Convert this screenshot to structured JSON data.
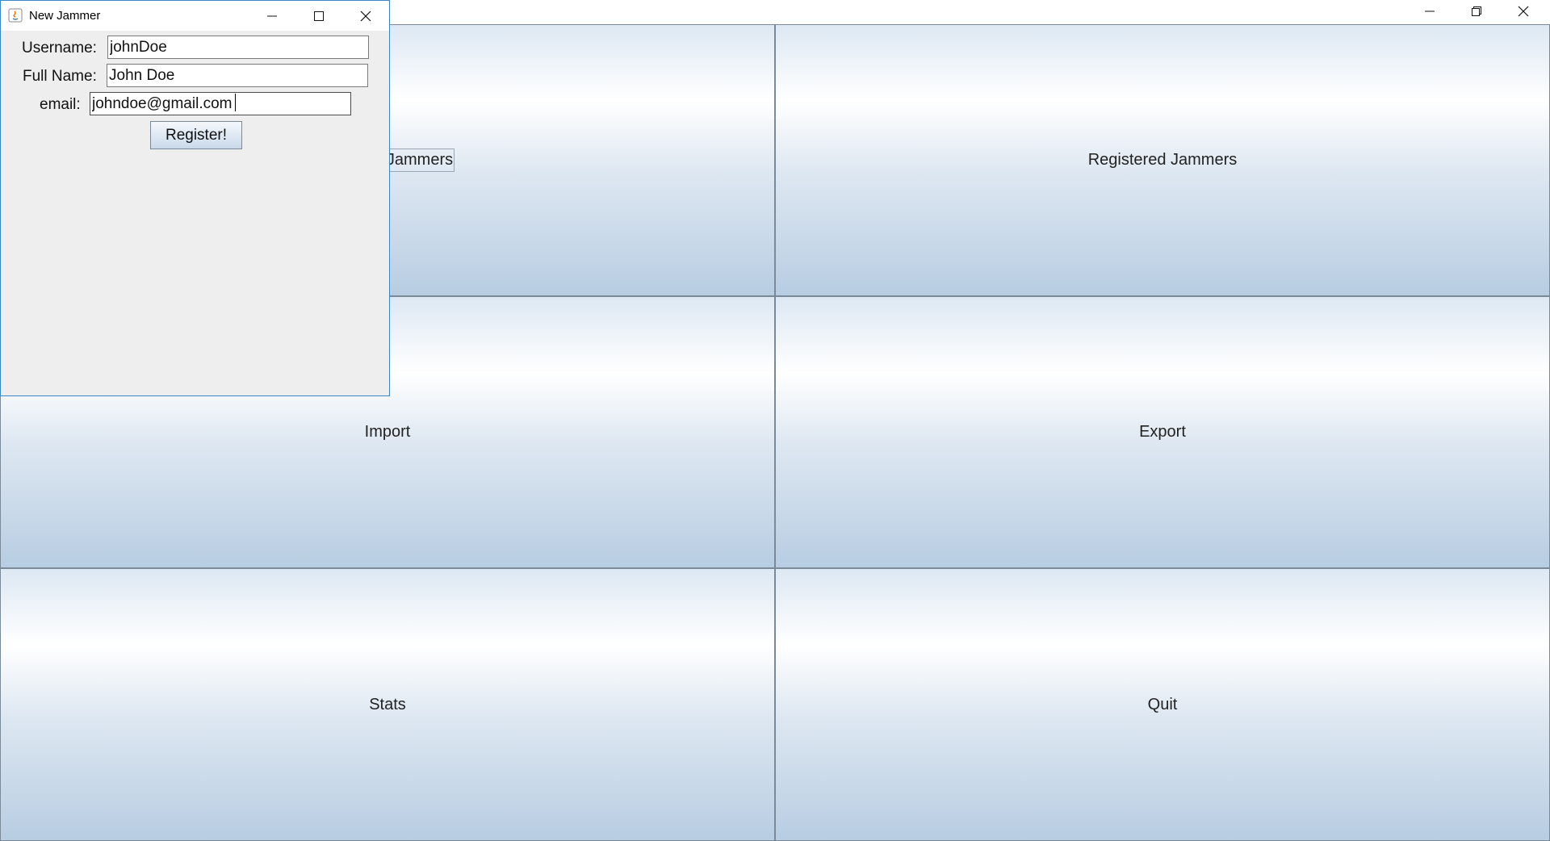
{
  "main_window": {
    "caption_buttons": {
      "minimize_icon": "minimize-icon",
      "restore_icon": "restore-icon",
      "close_icon": "close-icon"
    },
    "buttons": {
      "top_left": "Register Jammers",
      "top_right": "Registered Jammers",
      "middle_left": "Import",
      "middle_right": "Export",
      "bottom_left": "Stats",
      "bottom_right": "Quit"
    },
    "partial_visible_text": "mmers"
  },
  "dialog": {
    "title": "New Jammer",
    "fields": {
      "username": {
        "label": "Username:",
        "value": "johnDoe"
      },
      "full_name": {
        "label": "Full Name:",
        "value": "John Doe"
      },
      "email": {
        "label": "email:",
        "value": "johndoe@gmail.com"
      }
    },
    "register_label": "Register!"
  },
  "colors": {
    "button_gradient_top": "#dde8f3",
    "button_gradient_bottom": "#b8cde2",
    "dialog_border": "#3b86c6",
    "dialog_background": "#eeeeee"
  }
}
